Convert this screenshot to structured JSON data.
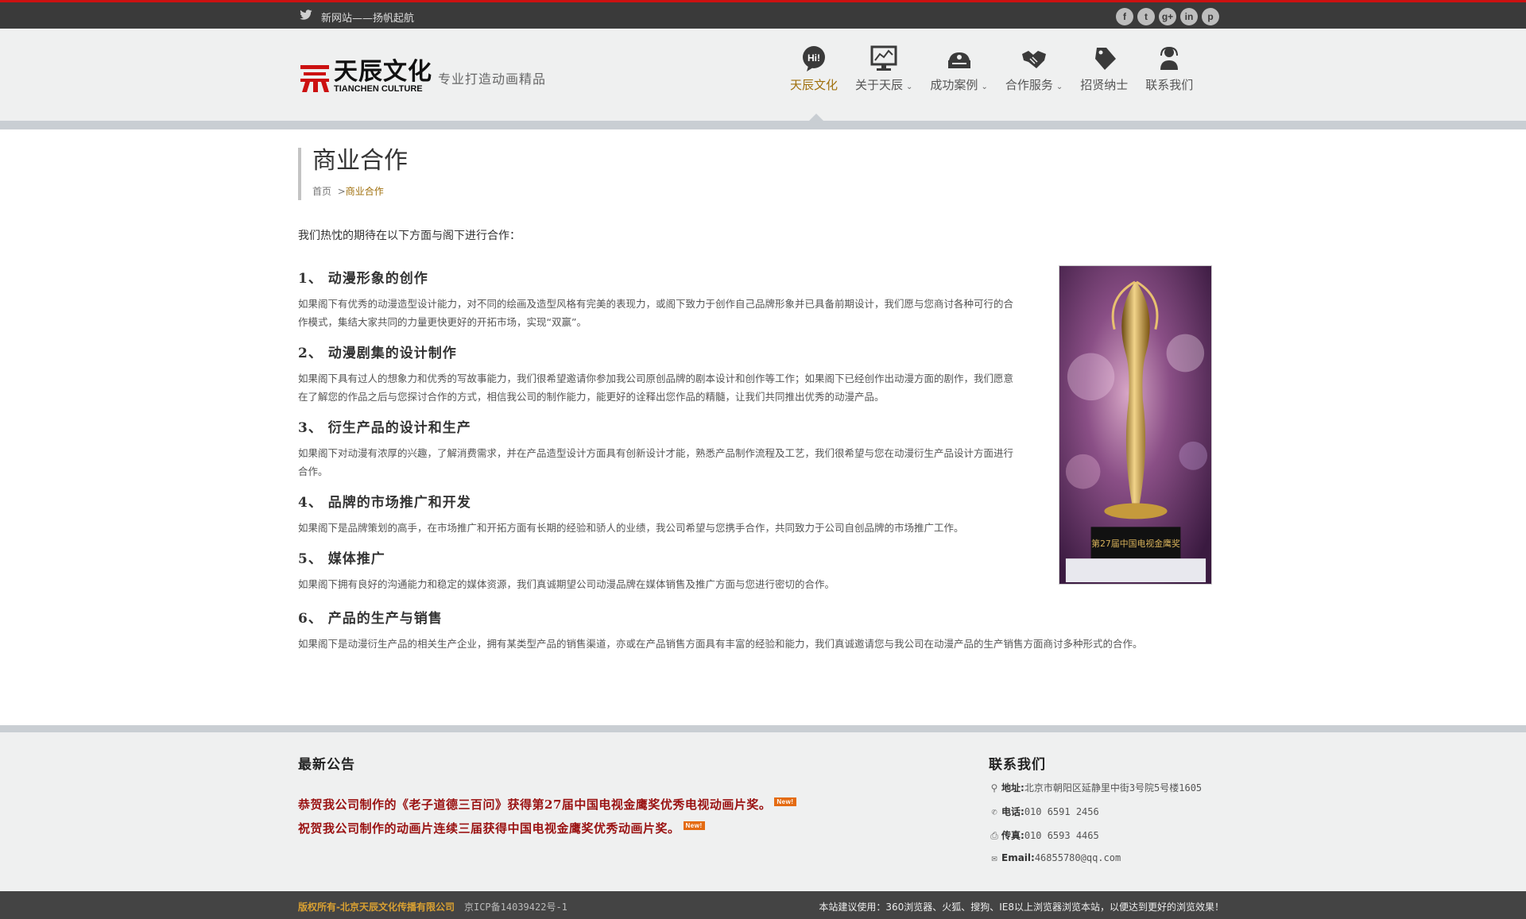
{
  "topbar": {
    "ticker": "新网站——扬帆起航",
    "social": [
      "facebook-icon",
      "twitter-icon",
      "google-plus-icon",
      "linkedin-icon",
      "pinterest-icon"
    ],
    "social_glyphs": [
      "f",
      "t",
      "g+",
      "in",
      "p"
    ]
  },
  "logo": {
    "cn": "天辰文化",
    "en": "TIANCHEN CULTURE",
    "slogan": "专业打造动画精品"
  },
  "nav": {
    "items": [
      {
        "label": "天辰文化",
        "icon": "hi-bubble-icon",
        "active": true
      },
      {
        "label": "关于天辰",
        "icon": "monitor-chart-icon",
        "dropdown": true
      },
      {
        "label": "成功案例",
        "icon": "cash-register-icon",
        "dropdown": true
      },
      {
        "label": "合作服务",
        "icon": "handshake-icon",
        "dropdown": true
      },
      {
        "label": "招贤纳士",
        "icon": "tag-icon"
      },
      {
        "label": "联系我们",
        "icon": "operator-icon"
      }
    ]
  },
  "page": {
    "title": "商业合作",
    "breadcrumb": {
      "home": "首页",
      "sep": ">",
      "current": "商业合作"
    },
    "intro": "我们热忱的期待在以下方面与阁下进行合作：",
    "sections": [
      {
        "heading": "1、  动漫形象的创作",
        "body": "如果阁下有优秀的动漫造型设计能力，对不同的绘画及造型风格有完美的表现力，或阁下致力于创作自己品牌形象并已具备前期设计，我们愿与您商讨各种可行的合作模式，集结大家共同的力量更快更好的开拓市场，实现“双赢”。"
      },
      {
        "heading": "2、  动漫剧集的设计制作",
        "body": "如果阁下具有过人的想象力和优秀的写故事能力，我们很希望邀请你参加我公司原创品牌的剧本设计和创作等工作；如果阁下已经创作出动漫方面的剧作，我们愿意在了解您的作品之后与您探讨合作的方式，相信我公司的制作能力，能更好的诠释出您作品的精髓，让我们共同推出优秀的动漫产品。"
      },
      {
        "heading": "3、  衍生产品的设计和生产",
        "body": "如果阁下对动漫有浓厚的兴趣，了解消费需求，并在产品造型设计方面具有创新设计才能，熟悉产品制作流程及工艺，我们很希望与您在动漫衍生产品设计方面进行合作。"
      },
      {
        "heading": "4、  品牌的市场推广和开发",
        "body": "如果阁下是品牌策划的高手，在市场推广和开拓方面有长期的经验和骄人的业绩，我公司希望与您携手合作，共同致力于公司自创品牌的市场推广工作。"
      },
      {
        "heading": "5、  媒体推广",
        "body": "如果阁下拥有良好的沟通能力和稳定的媒体资源，我们真诚期望公司动漫品牌在媒体销售及推广方面与您进行密切的合作。"
      },
      {
        "heading": "6、  产品的生产与销售",
        "body": "如果阁下是动漫衍生产品的相关生产企业，拥有某类型产品的销售渠道，亦或在产品销售方面具有丰富的经验和能力，我们真诚邀请您与我公司在动漫产品的生产销售方面商讨多种形式的合作。"
      }
    ],
    "trophy_caption": "第27届中国电视金鹰奖"
  },
  "footer": {
    "news_heading": "最新公告",
    "news": [
      {
        "text": "恭贺我公司制作的《老子道德三百问》获得第27届中国电视金鹰奖优秀电视动画片奖。",
        "tag": "New!"
      },
      {
        "text": "祝贺我公司制作的动画片连续三届获得中国电视金鹰奖优秀动画片奖。",
        "tag": "New!"
      }
    ],
    "contact_heading": "联系我们",
    "contact": [
      {
        "icon": "map-pin-icon",
        "label": "地址:",
        "value": "北京市朝阳区延静里中街3号院5号楼1605"
      },
      {
        "icon": "phone-icon",
        "label": "电话:",
        "value": "010 6591 2456"
      },
      {
        "icon": "fax-icon",
        "label": "传真:",
        "value": "010 6593 4465"
      },
      {
        "icon": "mail-icon",
        "label": "Email:",
        "value": "46855780@qq.com"
      }
    ]
  },
  "bottombar": {
    "copyright": "版权所有-北京天辰文化传播有限公司",
    "icp": "京ICP备14039422号-1",
    "browser_notice": "本站建议使用：360浏览器、火狐、搜狗、IE8以上浏览器浏览本站，以便达到更好的浏览效果！"
  },
  "colors": {
    "accent": "#a0700d",
    "red": "#cc1111",
    "news": "#9a1212"
  }
}
